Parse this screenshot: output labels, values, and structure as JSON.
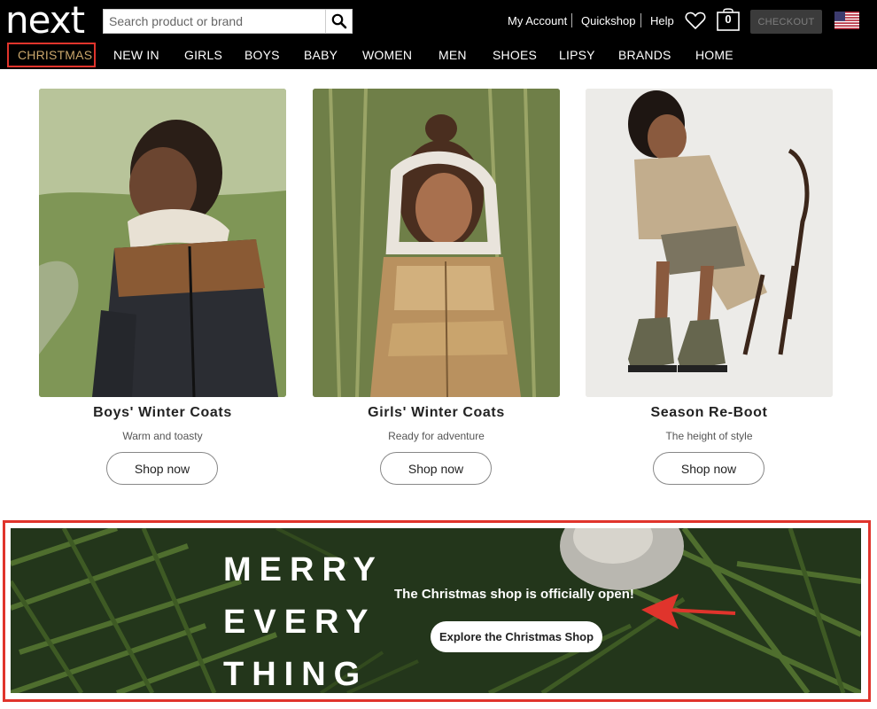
{
  "header": {
    "logo": "next",
    "search": {
      "placeholder": "Search product or brand",
      "value": ""
    },
    "links": {
      "account": "My Account",
      "quickshop": "Quickshop",
      "help": "Help"
    },
    "bag_count": "0",
    "checkout_label": "CHECKOUT",
    "icons": [
      "search-icon",
      "heart-icon",
      "bag-icon",
      "us-flag-icon"
    ]
  },
  "nav": {
    "items": [
      "CHRISTMAS",
      "NEW IN",
      "GIRLS",
      "BOYS",
      "BABY",
      "WOMEN",
      "MEN",
      "SHOES",
      "LIPSY",
      "BRANDS",
      "HOME"
    ],
    "highlighted": "CHRISTMAS",
    "accent": "#c9a66b"
  },
  "cards": [
    {
      "title": "Boys' Winter Coats",
      "subtitle": "Warm and toasty",
      "button": "Shop now"
    },
    {
      "title": "Girls' Winter Coats",
      "subtitle": "Ready for adventure",
      "button": "Shop now"
    },
    {
      "title": "Season Re-Boot",
      "subtitle": "The height of style",
      "button": "Shop now"
    }
  ],
  "banner": {
    "headline": [
      "MERRY",
      "EVERY",
      "THING"
    ],
    "text": "The Christmas shop is officially open!",
    "button": "Explore the Christmas Shop"
  },
  "colors": {
    "header_bg": "#000000",
    "annotation_red": "#e0342c"
  }
}
